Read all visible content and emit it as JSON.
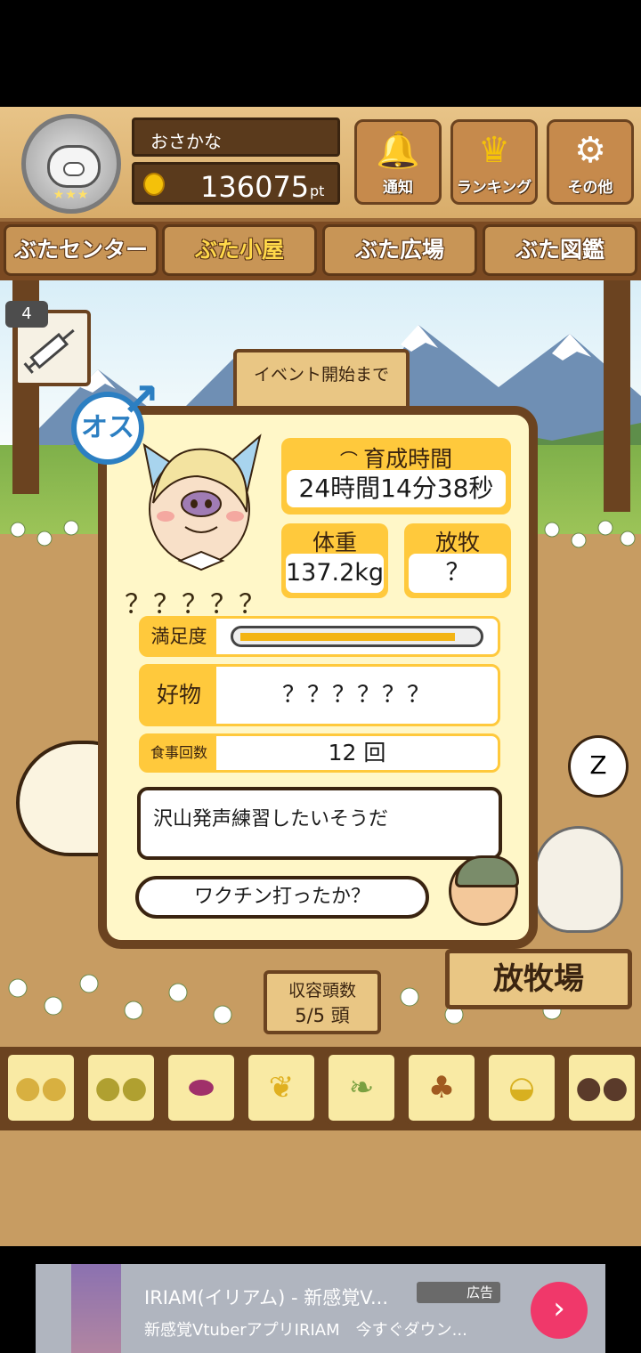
{
  "header": {
    "player_name": "おさかな",
    "points": "136075",
    "points_unit": "pt",
    "buttons": [
      {
        "label": "通知",
        "icon": "bell-icon"
      },
      {
        "label": "ランキング",
        "icon": "crown-icon"
      },
      {
        "label": "その他",
        "icon": "gear-icon"
      }
    ]
  },
  "tabs": [
    {
      "label": "ぶたセンター",
      "active": false
    },
    {
      "label": "ぶた小屋",
      "active": true
    },
    {
      "label": "ぶた広場",
      "active": false
    },
    {
      "label": "ぶた図鑑",
      "active": false
    }
  ],
  "scene": {
    "syringe_count": "4",
    "event_sign": "イベント開始まで",
    "capacity_title": "収容頭数",
    "capacity_value": "5/5 頭",
    "pasture_sign": "放牧場"
  },
  "pig_dialog": {
    "gender_label": "オス",
    "pig_name": "？？？？？",
    "growth_time_title": "育成時間",
    "growth_time_value": "24時間14分38秒",
    "weight_title": "体重",
    "weight_value": "137.2kg",
    "grazing_title": "放牧",
    "grazing_value": "？",
    "satisfaction_label": "満足度",
    "satisfaction_level": 0.92,
    "favorite_label": "好物",
    "favorite_value": "？？？？？？",
    "meals_label": "食事回数",
    "meals_value": "12 回",
    "pig_message": "沢山発声練習したいそうだ",
    "farmer_message": "ワクチン打ったか？"
  },
  "feed_items": [
    {
      "icon": "soybeans-icon"
    },
    {
      "icon": "mixed-grains-icon"
    },
    {
      "icon": "sweet-potato-icon"
    },
    {
      "icon": "corn-icon"
    },
    {
      "icon": "green-beans-icon"
    },
    {
      "icon": "acorns-icon"
    },
    {
      "icon": "bowl-of-grains-icon"
    },
    {
      "icon": "plate-of-meatballs-icon"
    }
  ],
  "ad": {
    "title": "IRIAM(イリアム) - 新感覚V...",
    "subtitle": "新感覚VtuberアプリIRIAM　今すぐダウン...",
    "badge": "広告",
    "cta_icon": "chevron-right-icon"
  },
  "colors": {
    "wood_dark": "#6b4320",
    "wood_light": "#c89556",
    "dialog_bg": "#fff7c8",
    "card_yellow": "#ffc93c",
    "male_blue": "#2c7fc2",
    "ad_cta": "#f0386a"
  }
}
